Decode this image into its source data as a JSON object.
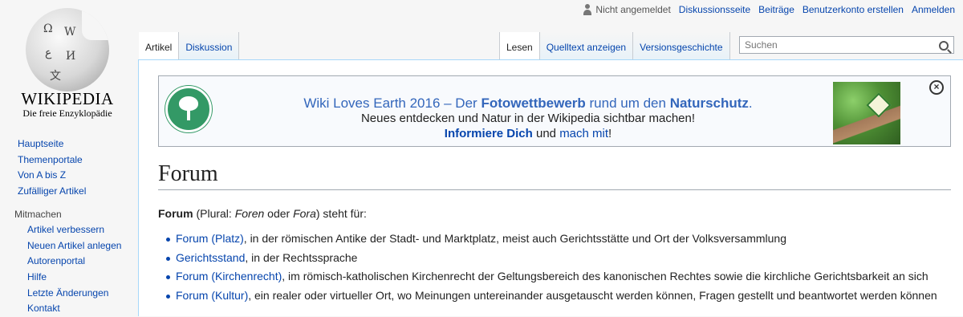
{
  "personal": {
    "anon": "Nicht angemeldet",
    "links": [
      "Diskussionsseite",
      "Beiträge",
      "Benutzerkonto erstellen",
      "Anmelden"
    ]
  },
  "logo": {
    "wordmark": "WIKIPEDIA",
    "tagline": "Die freie Enzyklopädie"
  },
  "sidebar": {
    "nav": [
      "Hauptseite",
      "Themenportale",
      "Von A bis Z",
      "Zufälliger Artikel"
    ],
    "section_heading": "Mitmachen",
    "section_items": [
      "Artikel verbessern",
      "Neuen Artikel anlegen",
      "Autorenportal",
      "Hilfe",
      "Letzte Änderungen",
      "Kontakt"
    ]
  },
  "tabs": {
    "left": [
      "Artikel",
      "Diskussion"
    ],
    "right": [
      "Lesen",
      "Quelltext anzeigen",
      "Versionsgeschichte"
    ]
  },
  "search": {
    "placeholder": "Suchen"
  },
  "banner": {
    "line1_pre": "Wiki Loves Earth 2016 – Der ",
    "line1_b1": "Fotowettbewerb",
    "line1_mid": " rund um den ",
    "line1_b2": "Naturschutz",
    "line1_end": ".",
    "line2": "Neues entdecken und Natur in der Wikipedia sichtbar machen!",
    "line3_link1": "Informiere Dich",
    "line3_mid": " und ",
    "line3_link2": "mach mit",
    "line3_end": "!"
  },
  "article": {
    "title": "Forum",
    "lead_bold": "Forum",
    "lead_pre": " (Plural: ",
    "lead_i1": "Foren",
    "lead_or": " oder ",
    "lead_i2": "Fora",
    "lead_post": ") steht für:",
    "items": [
      {
        "link": "Forum (Platz)",
        "text": ", in der römischen Antike der Stadt- und Marktplatz, meist auch Gerichtsstätte und Ort der Volksversammlung"
      },
      {
        "link": "Gerichtsstand",
        "text": ", in der Rechtssprache"
      },
      {
        "link": "Forum (Kirchenrecht)",
        "text": ", im römisch-katholischen Kirchenrecht der Geltungsbereich des kanonischen Rechtes sowie die kirchliche Gerichtsbarkeit an sich"
      },
      {
        "link": "Forum (Kultur)",
        "text": ", ein realer oder virtueller Ort, wo Meinungen untereinander ausgetauscht werden können, Fragen gestellt und beantwortet werden können"
      }
    ]
  },
  "colors": {
    "link": "#0645ad",
    "banner_text": "#3366bb",
    "banner_icon": "#339966"
  }
}
